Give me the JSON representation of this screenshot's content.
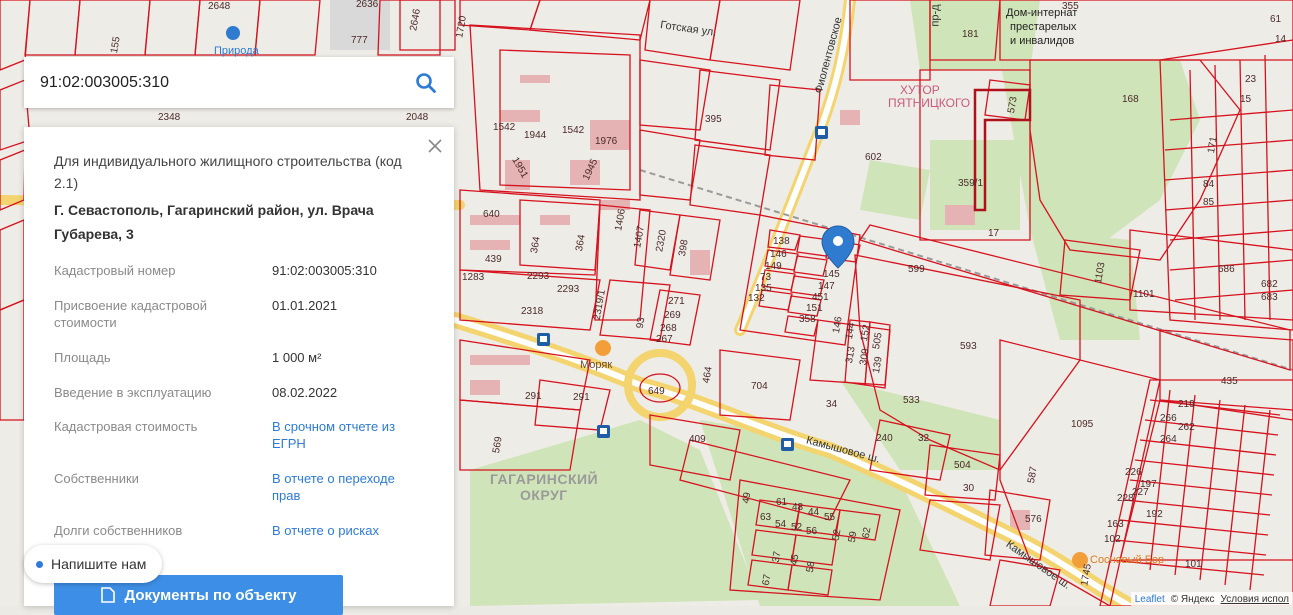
{
  "search": {
    "value": "91:02:003005:310",
    "placeholder": ""
  },
  "panel": {
    "purpose": "Для индивидуального жилищного строительства (код 2.1)",
    "address": "Г. Севастополь, Гагаринский район, ул. Врача Губарева, 3",
    "rows": [
      {
        "key": "Кадастровый номер",
        "value": "91:02:003005:310",
        "link": false
      },
      {
        "key": "Присвоение кадастровой стоимости",
        "value": "01.01.2021",
        "link": false
      },
      {
        "key": "Площадь",
        "value": "1 000 м²",
        "link": false
      },
      {
        "key": "Введение в эксплуатацию",
        "value": "08.02.2022",
        "link": false
      },
      {
        "key": "Кадастровая стоимость",
        "value": "В срочном отчете из ЕГРН",
        "link": true
      },
      {
        "key": "Собственники",
        "value": "В отчете о переходе прав",
        "link": true
      },
      {
        "key": "Долги собственников",
        "value": "В отчете о рисках",
        "link": true
      }
    ],
    "docs_button": "Документы по объекту"
  },
  "chat": {
    "label": "Напишите нам"
  },
  "attribution": {
    "leaflet": "Leaflet",
    "yandex": "© Яндекс",
    "terms": "Условия испол"
  },
  "map": {
    "pois": {
      "priroda": "Природа",
      "moryak": "Моряк",
      "sosnovy_bor": "Сосновый Бор",
      "dom_internat_1": "Дом-интернат",
      "dom_internat_2": "престарелых",
      "dom_internat_3": "и инвалидов",
      "khutor": "хутор",
      "pyatnitskogo": "Пятницкого"
    },
    "streets": {
      "gotskaya": "Готская ул.",
      "kamyshovoe_1": "Камышовое ш.",
      "kamyshovoe_2": "Камышовое ш.",
      "fiolentovskoe": "Фиолентовское",
      "pr": "пр-д"
    },
    "district": [
      "ГАГАРИНСКИЙ",
      "ОКРУГ"
    ],
    "parcel_labels": [
      "2648",
      "2636",
      "777",
      "2646",
      "1720",
      "155",
      "355",
      "181",
      "2348",
      "2048",
      "1542",
      "1944",
      "1542",
      "1976",
      "1951",
      "1945",
      "395",
      "640",
      "439",
      "364",
      "364",
      "1406",
      "1407",
      "2320",
      "398",
      "2293",
      "2293",
      "2319/1",
      "1283",
      "2318",
      "93",
      "271",
      "269",
      "268",
      "267",
      "138",
      "146",
      "149",
      "73",
      "135",
      "132",
      "145",
      "147",
      "451",
      "151",
      "358",
      "146",
      "144",
      "152",
      "505",
      "313",
      "309",
      "139",
      "602",
      "359/1",
      "17",
      "573",
      "168",
      "599",
      "1103",
      "1101",
      "593",
      "533",
      "704",
      "464",
      "649",
      "409",
      "240",
      "32",
      "504",
      "30",
      "587",
      "576",
      "1095",
      "435",
      "291",
      "291",
      "569",
      "34",
      "49",
      "63",
      "61",
      "48",
      "44",
      "55",
      "54",
      "52",
      "56",
      "52",
      "59",
      "62",
      "37",
      "45",
      "58",
      "67",
      "1745",
      "171",
      "84",
      "85",
      "682",
      "683",
      "686",
      "197",
      "226",
      "227",
      "228",
      "219",
      "266",
      "264",
      "262",
      "192",
      "163",
      "102",
      "101",
      "61",
      "14",
      "23",
      "15",
      "19"
    ]
  },
  "colors": {
    "parcel": "#d6121e",
    "accent": "#3d8ee6",
    "road": "#f5d26b",
    "green": "#c9e2b0"
  }
}
